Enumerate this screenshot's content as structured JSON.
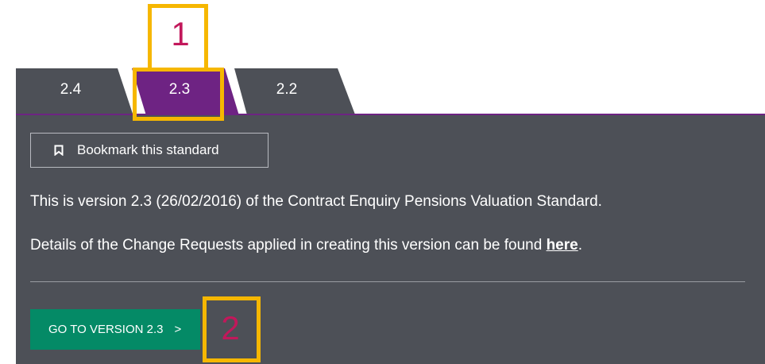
{
  "tabs": [
    {
      "label": "2.4",
      "active": false
    },
    {
      "label": "2.3",
      "active": true
    },
    {
      "label": "2.2",
      "active": false
    }
  ],
  "panel": {
    "bookmark_label": "Bookmark this standard",
    "description_prefix": "This is version 2.3 (26/02/2016) of the Contract Enquiry Pensions Valuation Standard.",
    "details_prefix": "Details of the Change Requests applied in creating this version can be found ",
    "details_link": "here",
    "details_suffix": ".",
    "go_button_label": "GO TO VERSION 2.3",
    "go_button_chevron": ">"
  },
  "annotations": [
    {
      "number": "1"
    },
    {
      "number": "2"
    }
  ],
  "colors": {
    "panel_bg": "#4d5057",
    "active_tab": "#6e2383",
    "go_button": "#048a66",
    "highlight": "#f6b700",
    "marker_text": "#c2185b"
  }
}
